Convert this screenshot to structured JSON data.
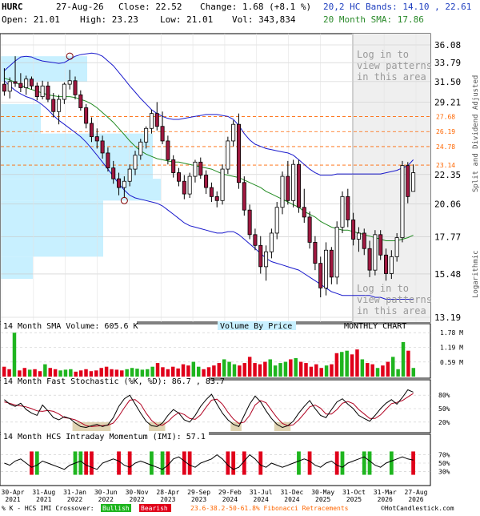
{
  "header": {
    "symbol": "HURC",
    "date": "27-Aug-26",
    "close": "Close: 22.52",
    "change": "Change: 1.68 (+8.1 %)",
    "open": "Open: 21.01",
    "high": "High: 23.23",
    "low": "Low: 21.01",
    "volume": "Vol: 343,834",
    "hc_bands": "20,2 HC Bands: 14.10 , 22.61",
    "sma_label": "20 Month SMA: 17.86"
  },
  "panels": {
    "volume_title": "14 Month SMA Volume: 605.6 K",
    "vbp_label": "Volume By Price",
    "chart_type": "MONTHLY CHART",
    "stoch_title": "14 Month Fast Stochastic (%K, %D): 86.7 , 83.7",
    "imi_title": "14 Month HCS Intraday Momentum (IMI): 57.1",
    "side_top": "Split and Dividend Adjusted",
    "side_bottom": "Logarithmic",
    "patterns_note_1": "Log in to view patterns in this area",
    "patterns_note_2": "Log in to view patterns in this area"
  },
  "footer": {
    "legend_prefix": "% K - HCS IMI Crossover:",
    "bullish": "Bullish",
    "bearish": "Bearish",
    "fib": "23.6-38.2-50-61.8% Fibonacci Retracements",
    "copyright": "©HotCandlestick.com"
  },
  "colors": {
    "bull": "#1fb51f",
    "bear": "#e0001a",
    "candle_up_fill": "#ffffff",
    "candle_down_fill": "#a01840",
    "band": "#1a1acc",
    "sma": "#228b22",
    "fib": "#ff6600",
    "vbp": "#c8f0ff",
    "grid": "#c8c8c8"
  },
  "chart_data": [
    {
      "type": "candlestick",
      "name": "price",
      "scale": "log",
      "ylim": [
        13.19,
        36.08
      ],
      "y_ticks": [
        "36.08",
        "33.79",
        "31.50",
        "29.21",
        "22.35",
        "20.06",
        "17.77",
        "15.48",
        "13.19"
      ],
      "fib_levels": [
        "27.68",
        "26.19",
        "24.78",
        "23.14"
      ],
      "x_labels": [
        "30-Apr 2021",
        "31-Aug 2021",
        "31-Jan 2022",
        "30-Jun 2022",
        "30-Nov 2022",
        "28-Apr 2023",
        "29-Sep 2023",
        "29-Feb 2024",
        "31-Jul 2024",
        "31-Dec 2024",
        "30-May 2025",
        "31-Oct 2025",
        "31-Mar 2026",
        "27-Aug 2026"
      ],
      "candles": [
        {
          "o": 31.2,
          "h": 33.1,
          "l": 29.9,
          "c": 30.4
        },
        {
          "o": 30.4,
          "h": 32.0,
          "l": 29.6,
          "c": 31.5
        },
        {
          "o": 31.5,
          "h": 34.6,
          "l": 30.9,
          "c": 31.3
        },
        {
          "o": 31.3,
          "h": 32.5,
          "l": 30.3,
          "c": 30.8
        },
        {
          "o": 30.8,
          "h": 32.2,
          "l": 30.0,
          "c": 31.8
        },
        {
          "o": 31.8,
          "h": 32.1,
          "l": 30.6,
          "c": 31.0
        },
        {
          "o": 31.0,
          "h": 31.4,
          "l": 29.4,
          "c": 29.8
        },
        {
          "o": 29.8,
          "h": 31.6,
          "l": 29.5,
          "c": 31.0
        },
        {
          "o": 31.0,
          "h": 31.5,
          "l": 29.2,
          "c": 29.5
        },
        {
          "o": 29.5,
          "h": 30.2,
          "l": 27.6,
          "c": 28.2
        },
        {
          "o": 28.2,
          "h": 30.0,
          "l": 26.9,
          "c": 29.5
        },
        {
          "o": 29.5,
          "h": 31.4,
          "l": 29.0,
          "c": 31.2
        },
        {
          "o": 31.2,
          "h": 32.9,
          "l": 30.6,
          "c": 31.6
        },
        {
          "o": 31.6,
          "h": 32.1,
          "l": 29.5,
          "c": 30.0
        },
        {
          "o": 30.0,
          "h": 30.5,
          "l": 28.3,
          "c": 28.6
        },
        {
          "o": 28.6,
          "h": 29.0,
          "l": 26.5,
          "c": 27.0
        },
        {
          "o": 27.0,
          "h": 27.6,
          "l": 25.2,
          "c": 25.7
        },
        {
          "o": 25.7,
          "h": 26.5,
          "l": 24.6,
          "c": 25.3
        },
        {
          "o": 25.3,
          "h": 25.8,
          "l": 23.7,
          "c": 24.2
        },
        {
          "o": 24.2,
          "h": 24.7,
          "l": 22.6,
          "c": 22.9
        },
        {
          "o": 22.9,
          "h": 23.5,
          "l": 21.6,
          "c": 22.0
        },
        {
          "o": 22.0,
          "h": 22.5,
          "l": 20.7,
          "c": 21.3
        },
        {
          "o": 21.3,
          "h": 22.2,
          "l": 20.5,
          "c": 21.8
        },
        {
          "o": 21.8,
          "h": 23.2,
          "l": 21.4,
          "c": 22.8
        },
        {
          "o": 22.8,
          "h": 24.4,
          "l": 22.3,
          "c": 24.0
        },
        {
          "o": 24.0,
          "h": 25.5,
          "l": 23.6,
          "c": 25.2
        },
        {
          "o": 25.2,
          "h": 26.7,
          "l": 24.6,
          "c": 26.5
        },
        {
          "o": 26.5,
          "h": 28.4,
          "l": 26.0,
          "c": 28.0
        },
        {
          "o": 28.0,
          "h": 29.2,
          "l": 26.3,
          "c": 26.7
        },
        {
          "o": 26.7,
          "h": 28.2,
          "l": 25.0,
          "c": 25.3
        },
        {
          "o": 25.3,
          "h": 25.8,
          "l": 23.2,
          "c": 23.6
        },
        {
          "o": 23.6,
          "h": 24.0,
          "l": 22.1,
          "c": 22.5
        },
        {
          "o": 22.5,
          "h": 22.9,
          "l": 21.4,
          "c": 21.8
        },
        {
          "o": 21.8,
          "h": 22.3,
          "l": 20.4,
          "c": 20.8
        },
        {
          "o": 20.8,
          "h": 22.5,
          "l": 20.5,
          "c": 22.2
        },
        {
          "o": 22.2,
          "h": 23.6,
          "l": 21.7,
          "c": 23.4
        },
        {
          "o": 23.4,
          "h": 23.8,
          "l": 22.0,
          "c": 22.3
        },
        {
          "o": 22.3,
          "h": 22.7,
          "l": 20.8,
          "c": 21.3
        },
        {
          "o": 21.3,
          "h": 21.7,
          "l": 20.2,
          "c": 20.6
        },
        {
          "o": 20.6,
          "h": 21.0,
          "l": 19.8,
          "c": 20.3
        },
        {
          "o": 20.3,
          "h": 23.2,
          "l": 20.0,
          "c": 22.8
        },
        {
          "o": 22.8,
          "h": 25.7,
          "l": 22.4,
          "c": 25.3
        },
        {
          "o": 25.3,
          "h": 27.3,
          "l": 24.8,
          "c": 26.9
        },
        {
          "o": 26.9,
          "h": 28.0,
          "l": 21.2,
          "c": 21.7
        },
        {
          "o": 21.7,
          "h": 22.2,
          "l": 19.2,
          "c": 19.6
        },
        {
          "o": 19.6,
          "h": 20.0,
          "l": 17.6,
          "c": 17.9
        },
        {
          "o": 17.9,
          "h": 18.3,
          "l": 16.9,
          "c": 17.2
        },
        {
          "o": 17.2,
          "h": 17.8,
          "l": 15.5,
          "c": 15.9
        },
        {
          "o": 15.9,
          "h": 17.2,
          "l": 15.1,
          "c": 16.8
        },
        {
          "o": 16.8,
          "h": 18.3,
          "l": 16.4,
          "c": 18.0
        },
        {
          "o": 18.0,
          "h": 20.2,
          "l": 17.6,
          "c": 19.8
        },
        {
          "o": 19.8,
          "h": 22.6,
          "l": 19.3,
          "c": 22.2
        },
        {
          "o": 22.2,
          "h": 23.5,
          "l": 20.0,
          "c": 20.3
        },
        {
          "o": 20.3,
          "h": 23.6,
          "l": 19.8,
          "c": 23.2
        },
        {
          "o": 23.2,
          "h": 23.6,
          "l": 19.4,
          "c": 19.8
        },
        {
          "o": 19.8,
          "h": 21.2,
          "l": 18.7,
          "c": 19.1
        },
        {
          "o": 19.1,
          "h": 19.5,
          "l": 17.0,
          "c": 17.4
        },
        {
          "o": 17.4,
          "h": 17.8,
          "l": 15.7,
          "c": 16.1
        },
        {
          "o": 16.1,
          "h": 16.5,
          "l": 14.2,
          "c": 14.7
        },
        {
          "o": 14.7,
          "h": 17.4,
          "l": 14.3,
          "c": 16.9
        },
        {
          "o": 16.9,
          "h": 17.1,
          "l": 14.9,
          "c": 15.3
        },
        {
          "o": 15.3,
          "h": 18.8,
          "l": 14.9,
          "c": 18.4
        },
        {
          "o": 18.4,
          "h": 21.0,
          "l": 18.0,
          "c": 20.6
        },
        {
          "o": 20.6,
          "h": 21.2,
          "l": 18.4,
          "c": 18.9
        },
        {
          "o": 18.9,
          "h": 19.4,
          "l": 17.2,
          "c": 17.6
        },
        {
          "o": 17.6,
          "h": 18.4,
          "l": 16.8,
          "c": 18.0
        },
        {
          "o": 18.0,
          "h": 18.3,
          "l": 16.6,
          "c": 17.0
        },
        {
          "o": 17.0,
          "h": 17.5,
          "l": 15.3,
          "c": 15.7
        },
        {
          "o": 15.7,
          "h": 18.2,
          "l": 15.4,
          "c": 17.9
        },
        {
          "o": 17.9,
          "h": 18.2,
          "l": 16.3,
          "c": 16.6
        },
        {
          "o": 16.6,
          "h": 17.0,
          "l": 15.1,
          "c": 15.5
        },
        {
          "o": 15.5,
          "h": 16.9,
          "l": 15.2,
          "c": 16.5
        },
        {
          "o": 16.5,
          "h": 18.0,
          "l": 16.2,
          "c": 17.7
        },
        {
          "o": 17.7,
          "h": 23.5,
          "l": 17.4,
          "c": 23.1
        },
        {
          "o": 23.1,
          "h": 23.4,
          "l": 20.1,
          "c": 20.6
        },
        {
          "o": 21.0,
          "h": 23.2,
          "l": 21.0,
          "c": 22.5
        }
      ],
      "upper_band": [
        32.8,
        33.4,
        34.0,
        34.5,
        34.6,
        34.5,
        34.2,
        34.0,
        33.9,
        33.8,
        33.7,
        33.8,
        34.2,
        34.6,
        34.8,
        34.9,
        35.0,
        34.9,
        34.6,
        34.0,
        33.4,
        32.6,
        31.8,
        31.0,
        30.3,
        29.6,
        29.0,
        28.4,
        28.0,
        27.7,
        27.5,
        27.4,
        27.4,
        27.5,
        27.6,
        27.7,
        27.8,
        27.9,
        27.9,
        27.9,
        27.8,
        27.7,
        27.4,
        26.8,
        26.0,
        25.4,
        25.0,
        24.8,
        24.6,
        24.5,
        24.4,
        24.3,
        24.2,
        24.0,
        23.6,
        23.2,
        22.8,
        22.5,
        22.3,
        22.3,
        22.3,
        22.4,
        22.4,
        22.4,
        22.4,
        22.4,
        22.4,
        22.4,
        22.4,
        22.4,
        22.5,
        22.6,
        22.7,
        22.9,
        23.1,
        23.6
      ],
      "lower_band": [
        31.6,
        31.0,
        30.5,
        30.1,
        29.8,
        29.6,
        29.3,
        28.9,
        28.4,
        27.8,
        27.3,
        26.9,
        26.5,
        26.1,
        25.7,
        25.2,
        24.6,
        24.0,
        23.4,
        22.8,
        22.2,
        21.6,
        21.1,
        20.7,
        20.5,
        20.4,
        20.3,
        20.2,
        20.1,
        19.9,
        19.6,
        19.3,
        19.0,
        18.7,
        18.5,
        18.4,
        18.3,
        18.2,
        18.1,
        18.0,
        18.0,
        18.1,
        18.1,
        17.9,
        17.6,
        17.3,
        17.0,
        16.7,
        16.4,
        16.2,
        16.1,
        16.0,
        15.9,
        15.8,
        15.7,
        15.5,
        15.3,
        15.1,
        14.9,
        14.7,
        14.5,
        14.4,
        14.3,
        14.3,
        14.3,
        14.3,
        14.3,
        14.3,
        14.2,
        14.2,
        14.1,
        14.1,
        14.1,
        14.1,
        14.1,
        14.1
      ],
      "sma": [
        31.9,
        31.7,
        31.4,
        31.1,
        30.8,
        30.6,
        30.4,
        30.2,
        30.0,
        29.9,
        29.8,
        29.8,
        29.8,
        29.7,
        29.5,
        29.3,
        29.0,
        28.6,
        28.1,
        27.6,
        27.1,
        26.5,
        25.9,
        25.3,
        24.8,
        24.4,
        24.1,
        23.9,
        23.7,
        23.6,
        23.5,
        23.4,
        23.4,
        23.3,
        23.2,
        23.1,
        23.0,
        22.9,
        22.8,
        22.6,
        22.4,
        22.3,
        22.2,
        22.1,
        21.9,
        21.7,
        21.5,
        21.3,
        21.0,
        20.8,
        20.6,
        20.4,
        20.2,
        20.0,
        19.8,
        19.5,
        19.3,
        19.1,
        18.8,
        18.6,
        18.4,
        18.3,
        18.2,
        18.2,
        18.1,
        18.0,
        17.9,
        17.8,
        17.7,
        17.6,
        17.5,
        17.5,
        17.5,
        17.6,
        17.7,
        17.86
      ]
    },
    {
      "type": "bar",
      "name": "volume",
      "y_ticks": [
        "1.78 M",
        "1.19 M",
        "0.59 M"
      ],
      "ylim": [
        0,
        1.95
      ],
      "values": [
        0.4,
        0.3,
        1.78,
        0.25,
        0.35,
        0.28,
        0.3,
        0.22,
        0.5,
        0.35,
        0.3,
        0.25,
        0.28,
        0.3,
        0.2,
        0.25,
        0.3,
        0.22,
        0.25,
        0.35,
        0.4,
        0.3,
        0.28,
        0.25,
        0.3,
        0.35,
        0.32,
        0.28,
        0.3,
        0.4,
        0.55,
        0.38,
        0.3,
        0.4,
        0.33,
        0.5,
        0.45,
        0.6,
        0.4,
        0.3,
        0.38,
        0.45,
        0.55,
        0.7,
        0.6,
        0.5,
        0.45,
        0.55,
        0.8,
        0.55,
        0.5,
        0.6,
        0.7,
        0.45,
        0.55,
        0.6,
        0.7,
        0.75,
        0.6,
        0.55,
        0.4,
        0.5,
        0.35,
        0.45,
        0.5,
        0.95,
        1.0,
        1.05,
        0.9,
        1.1,
        0.7,
        0.55,
        0.5,
        0.35,
        0.45,
        0.6,
        0.8,
        0.3,
        1.4,
        1.05,
        0.35
      ]
    },
    {
      "type": "line",
      "name": "stochastic",
      "y_ticks": [
        "80%",
        "50%",
        "20%"
      ],
      "ylim": [
        0,
        100
      ],
      "k": [
        70,
        60,
        55,
        62,
        48,
        40,
        35,
        58,
        45,
        30,
        25,
        32,
        28,
        18,
        10,
        8,
        12,
        15,
        10,
        14,
        30,
        55,
        72,
        80,
        60,
        40,
        22,
        12,
        10,
        18,
        35,
        48,
        40,
        25,
        20,
        35,
        55,
        70,
        82,
        60,
        40,
        25,
        15,
        10,
        35,
        60,
        78,
        65,
        45,
        28,
        15,
        8,
        12,
        22,
        40,
        55,
        68,
        50,
        35,
        30,
        48,
        65,
        72,
        60,
        50,
        35,
        28,
        22,
        35,
        50,
        62,
        70,
        60,
        75,
        92,
        86.7
      ],
      "d": [
        65,
        62,
        58,
        56,
        54,
        50,
        45,
        44,
        46,
        44,
        38,
        30,
        28,
        25,
        19,
        12,
        10,
        11,
        12,
        13,
        18,
        33,
        52,
        69,
        70,
        60,
        40,
        24,
        14,
        13,
        21,
        33,
        41,
        37,
        28,
        26,
        36,
        53,
        69,
        71,
        60,
        42,
        27,
        17,
        20,
        35,
        58,
        68,
        63,
        46,
        30,
        17,
        12,
        14,
        25,
        39,
        54,
        58,
        51,
        38,
        38,
        48,
        62,
        66,
        61,
        48,
        38,
        28,
        28,
        36,
        49,
        61,
        64,
        68,
        76,
        83.7
      ]
    },
    {
      "type": "line",
      "name": "imi",
      "y_ticks": [
        "70%",
        "50%",
        "30%"
      ],
      "ylim": [
        0,
        100
      ],
      "values": [
        50,
        45,
        55,
        60,
        50,
        40,
        45,
        55,
        50,
        45,
        40,
        35,
        45,
        50,
        55,
        45,
        40,
        35,
        50,
        55,
        60,
        55,
        45,
        40,
        50,
        55,
        50,
        45,
        40,
        35,
        45,
        60,
        65,
        55,
        45,
        40,
        50,
        55,
        60,
        70,
        60,
        45,
        35,
        40,
        55,
        70,
        60,
        45,
        40,
        50,
        45,
        40,
        45,
        50,
        55,
        60,
        55,
        45,
        40,
        50,
        55,
        45,
        40,
        50,
        55,
        60,
        65,
        55,
        45,
        40,
        50,
        55,
        60,
        65,
        60,
        57.1
      ],
      "signals_bull": [
        6,
        13,
        14,
        27,
        29,
        54,
        62,
        66,
        67,
        71
      ],
      "signals_bear": [
        5,
        15,
        16,
        21,
        23,
        30,
        33,
        34,
        41,
        42,
        44,
        47,
        56,
        61,
        75
      ]
    }
  ]
}
